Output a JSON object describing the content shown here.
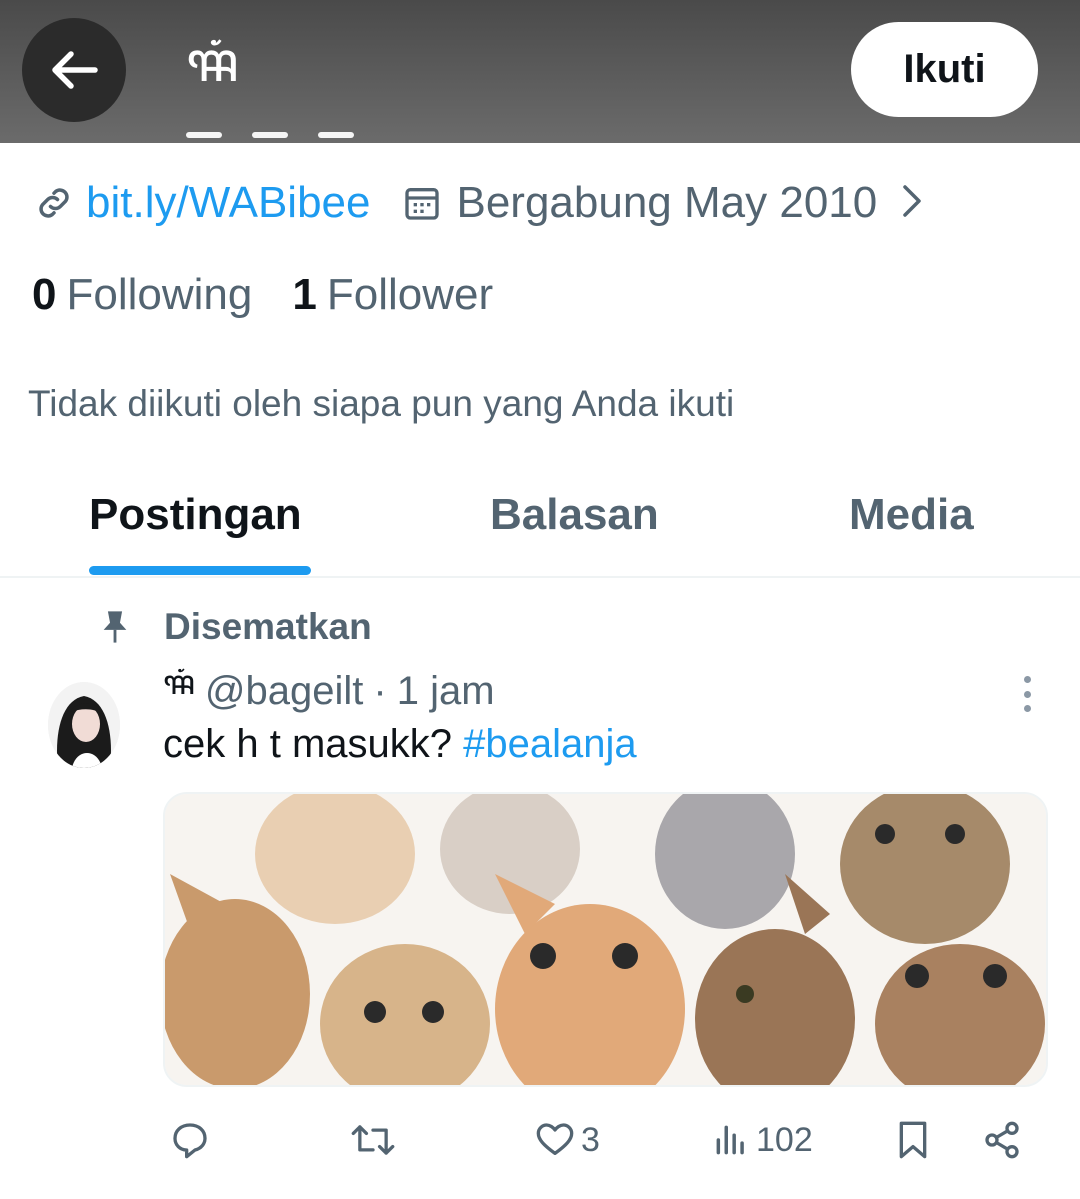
{
  "header": {
    "display_name": "ꦯꦁ",
    "follow_label": "Ikuti"
  },
  "profile": {
    "link": "bit.ly/WABibee",
    "joined": "Bergabung May 2010",
    "following_count": "0",
    "following_label": "Following",
    "follower_count": "1",
    "follower_label": "Follower",
    "not_followed_text": "Tidak diikuti oleh siapa pun yang Anda ikuti"
  },
  "tabs": [
    {
      "label": "Postingan",
      "active": true
    },
    {
      "label": "Balasan",
      "active": false
    },
    {
      "label": "Media",
      "active": false
    }
  ],
  "post": {
    "pinned_label": "Disematkan",
    "author_name": "ꦯꦁ",
    "handle": "@bageilt",
    "separator": "·",
    "time": "1 jam",
    "text_before": "cek h t masukk? ",
    "hashtag": "#bealanja",
    "actions": {
      "replies": "",
      "reposts": "",
      "likes": "3",
      "views": "102"
    }
  },
  "colors": {
    "accent": "#1d9bf0",
    "secondary_text": "#536471",
    "primary_text": "#0f1419"
  }
}
